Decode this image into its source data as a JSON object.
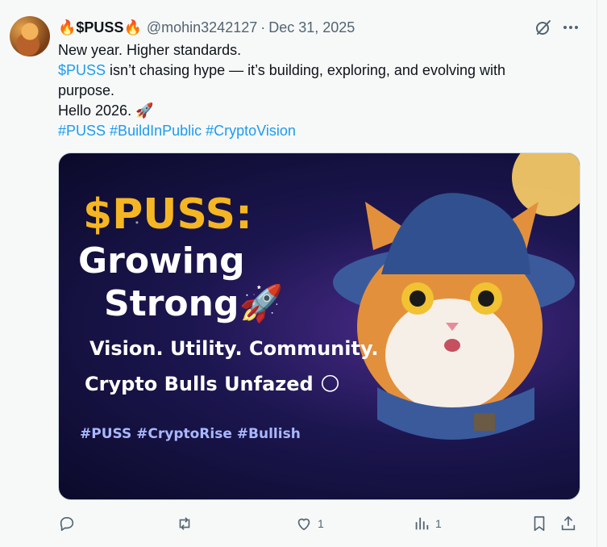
{
  "tweet": {
    "display_name": "🔥$PUSS🔥",
    "handle": "@mohin3242127",
    "separator": "·",
    "date": "Dec 31, 2025",
    "lines": {
      "l1": "New year. Higher standards.",
      "l2_link": "$PUSS",
      "l2_rest": " isn’t chasing hype — it’s building, exploring, and evolving with",
      "l3": "purpose.",
      "l4": "Hello 2026. 🚀",
      "hashtag1": "#PUSS",
      "hashtag2": "#BuildInPublic",
      "hashtag3": "#CryptoVision"
    }
  },
  "media": {
    "headline": "$PUSS:",
    "line2": "Growing",
    "line3": "Strong🚀",
    "tagline": "Vision. Utility. Community.",
    "subtagline": "Crypto Bulls Unfazed 🌕",
    "hashtags": "#PUSS #CryptoRise #Bullish"
  },
  "actions": {
    "reply_icon": "reply-icon",
    "retweet_icon": "retweet-icon",
    "like_icon": "heart-icon",
    "like_count": "1",
    "views_icon": "views-icon",
    "views_count": "1",
    "bookmark_icon": "bookmark-icon",
    "share_icon": "share-icon"
  },
  "colors": {
    "link": "#1d9bf0",
    "muted": "#536471",
    "text": "#0f1419",
    "headline_gold": "#f5b623"
  }
}
